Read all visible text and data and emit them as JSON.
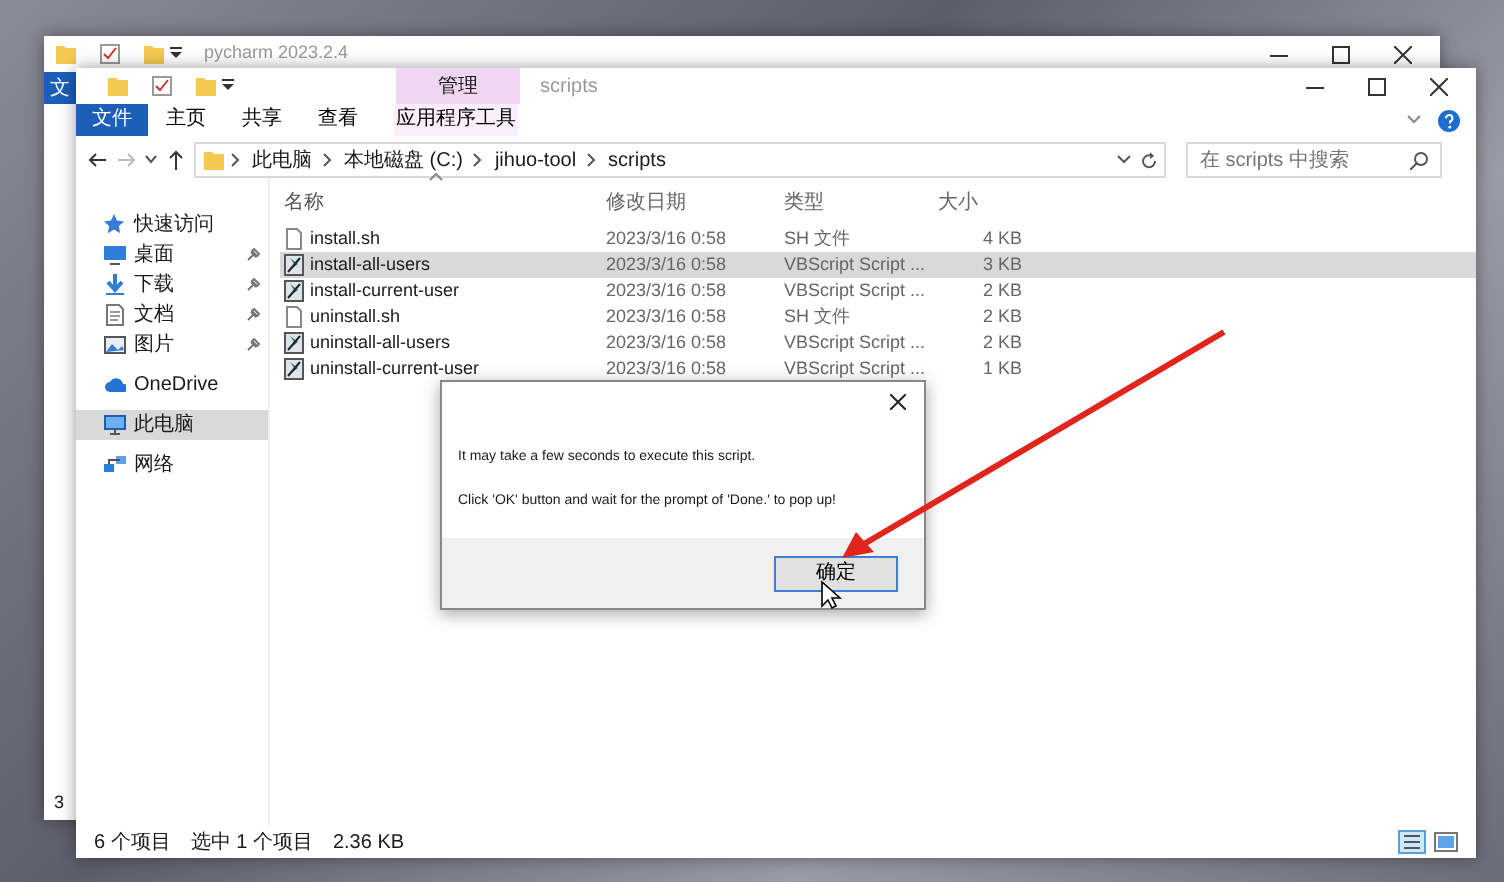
{
  "back_window": {
    "title": "pycharm 2023.2.4",
    "tab_label": "文",
    "side_text": "3"
  },
  "window": {
    "context_tab": "管理",
    "title": "scripts"
  },
  "ribbon_tabs": [
    {
      "label": "文件",
      "kind": "file"
    },
    {
      "label": "主页",
      "kind": "plain"
    },
    {
      "label": "共享",
      "kind": "plain"
    },
    {
      "label": "查看",
      "kind": "plain"
    },
    {
      "label": "应用程序工具",
      "kind": "context"
    }
  ],
  "address": {
    "crumbs": [
      "此电脑",
      "本地磁盘 (C:)",
      "jihuo-tool",
      "scripts"
    ]
  },
  "search": {
    "placeholder": "在 scripts 中搜索"
  },
  "sidebar": {
    "items": [
      {
        "label": "快速访问",
        "selected": false,
        "children": [
          {
            "label": "桌面",
            "pinned": true,
            "selected": false
          },
          {
            "label": "下载",
            "pinned": true,
            "selected": false
          },
          {
            "label": "文档",
            "pinned": true,
            "selected": false
          },
          {
            "label": "图片",
            "pinned": true,
            "selected": false
          }
        ]
      },
      {
        "label": "OneDrive",
        "selected": false
      },
      {
        "label": "此电脑",
        "selected": true
      },
      {
        "label": "网络",
        "selected": false
      }
    ]
  },
  "table": {
    "columns": [
      "名称",
      "修改日期",
      "类型",
      "大小"
    ],
    "rows": [
      {
        "name": "install.sh",
        "kind": "sh",
        "modified": "2023/3/16 0:58",
        "type": "SH 文件",
        "size": "4 KB",
        "selected": false
      },
      {
        "name": "install-all-users",
        "kind": "vbs",
        "modified": "2023/3/16 0:58",
        "type": "VBScript Script ...",
        "size": "3 KB",
        "selected": true
      },
      {
        "name": "install-current-user",
        "kind": "vbs",
        "modified": "2023/3/16 0:58",
        "type": "VBScript Script ...",
        "size": "2 KB",
        "selected": false
      },
      {
        "name": "uninstall.sh",
        "kind": "sh",
        "modified": "2023/3/16 0:58",
        "type": "SH 文件",
        "size": "2 KB",
        "selected": false
      },
      {
        "name": "uninstall-all-users",
        "kind": "vbs",
        "modified": "2023/3/16 0:58",
        "type": "VBScript Script ...",
        "size": "2 KB",
        "selected": false
      },
      {
        "name": "uninstall-current-user",
        "kind": "vbs",
        "modified": "2023/3/16 0:58",
        "type": "VBScript Script ...",
        "size": "1 KB",
        "selected": false
      }
    ]
  },
  "status_bar": {
    "count": "6 个项目",
    "selection": "选中 1 个项目",
    "size": "2.36 KB"
  },
  "dialog": {
    "lines": [
      "It may take a few seconds to execute this script.",
      "Click 'OK' button and wait for the prompt of 'Done.' to pop up!"
    ],
    "button": "确定"
  }
}
